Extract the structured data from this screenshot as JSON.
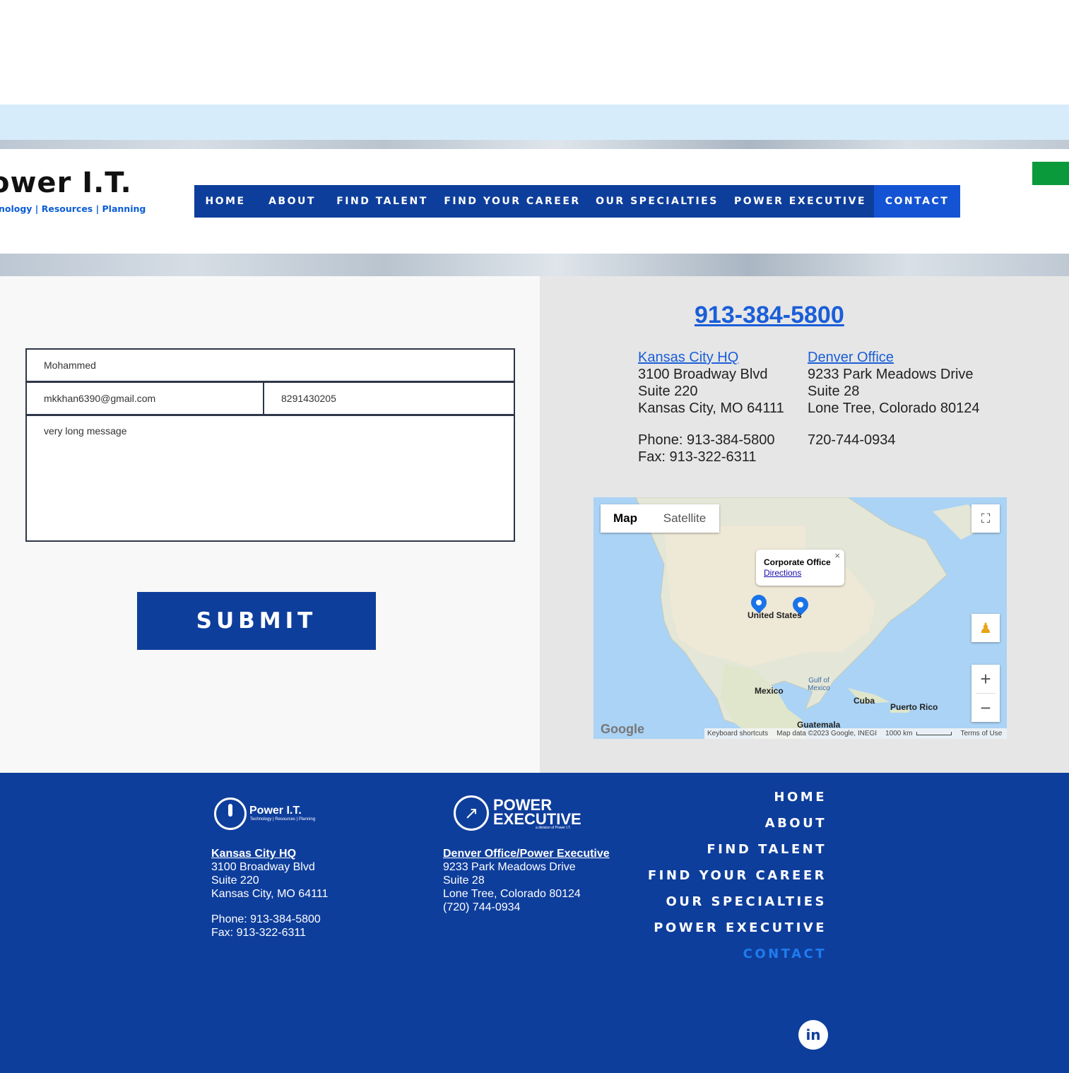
{
  "header": {
    "logo_title": "ower I.T.",
    "logo_tagline": "nology | Resources | Planning"
  },
  "nav": {
    "items": [
      {
        "label": "HOME",
        "active": false
      },
      {
        "label": "ABOUT",
        "active": false
      },
      {
        "label": "FIND TALENT",
        "active": false
      },
      {
        "label": "FIND YOUR CAREER",
        "active": false
      },
      {
        "label": "OUR SPECIALTIES",
        "active": false
      },
      {
        "label": "POWER EXECUTIVE",
        "active": false
      },
      {
        "label": "CONTACT",
        "active": true
      }
    ]
  },
  "form": {
    "name_value": "Mohammed",
    "email_value": "mkkhan6390@gmail.com",
    "phone_value": "8291430205",
    "message_value": "very long message",
    "submit_label": "SUBMIT"
  },
  "contact": {
    "main_phone": "913-384-5800",
    "kc": {
      "title": "Kansas City HQ",
      "line1": "3100 Broadway Blvd",
      "line2": "Suite 220",
      "line3": "Kansas City, MO 64111",
      "phone": "Phone: 913-384-5800",
      "fax": "Fax: 913-322-6311"
    },
    "denver": {
      "title": "Denver Office",
      "line1": "9233 Park Meadows Drive",
      "line2": "Suite 28",
      "line3": "Lone Tree, Colorado 80124",
      "phone": "720-744-0934"
    }
  },
  "map": {
    "type_map": "Map",
    "type_satellite": "Satellite",
    "popup_title": "Corporate Office",
    "popup_link": "Directions",
    "labels": {
      "us": "United States",
      "mexico": "Mexico",
      "cuba": "Cuba",
      "puerto_rico": "Puerto Rico",
      "guatemala": "Guatemala",
      "gulf": "Gulf of Mexico"
    },
    "attribution": {
      "logo": "Google",
      "shortcuts": "Keyboard shortcuts",
      "data": "Map data ©2023 Google, INEGI",
      "scale": "1000 km",
      "terms": "Terms of Use"
    }
  },
  "footer": {
    "logo1_title": "Power I.T.",
    "logo1_tagline": "Technology | Resources | Planning",
    "logo2_line1": "POWER",
    "logo2_line2": "EXECUTIVE",
    "logo2_sub": "a division of Power I.T.",
    "kc": {
      "title": "Kansas City HQ",
      "line1": "3100 Broadway Blvd",
      "line2": "Suite 220",
      "line3": "Kansas City, MO 64111",
      "phone": "Phone: 913-384-5800",
      "fax": "Fax: 913-322-6311"
    },
    "denver": {
      "title": "Denver Office/Power Executive",
      "line1": "9233 Park Meadows Drive",
      "line2": "Suite 28",
      "line3": "Lone Tree, Colorado 80124",
      "phone": "(720) 744-0934"
    },
    "nav": [
      "HOME",
      "ABOUT",
      "FIND TALENT",
      "FIND YOUR CAREER",
      "OUR SPECIALTIES",
      "POWER EXECUTIVE",
      "CONTACT"
    ],
    "linkedin": "in"
  },
  "colors": {
    "brand_blue": "#0e3e9c",
    "active_blue": "#1453d4",
    "link_blue": "#1a5ed8",
    "green": "#0a9a3b"
  }
}
